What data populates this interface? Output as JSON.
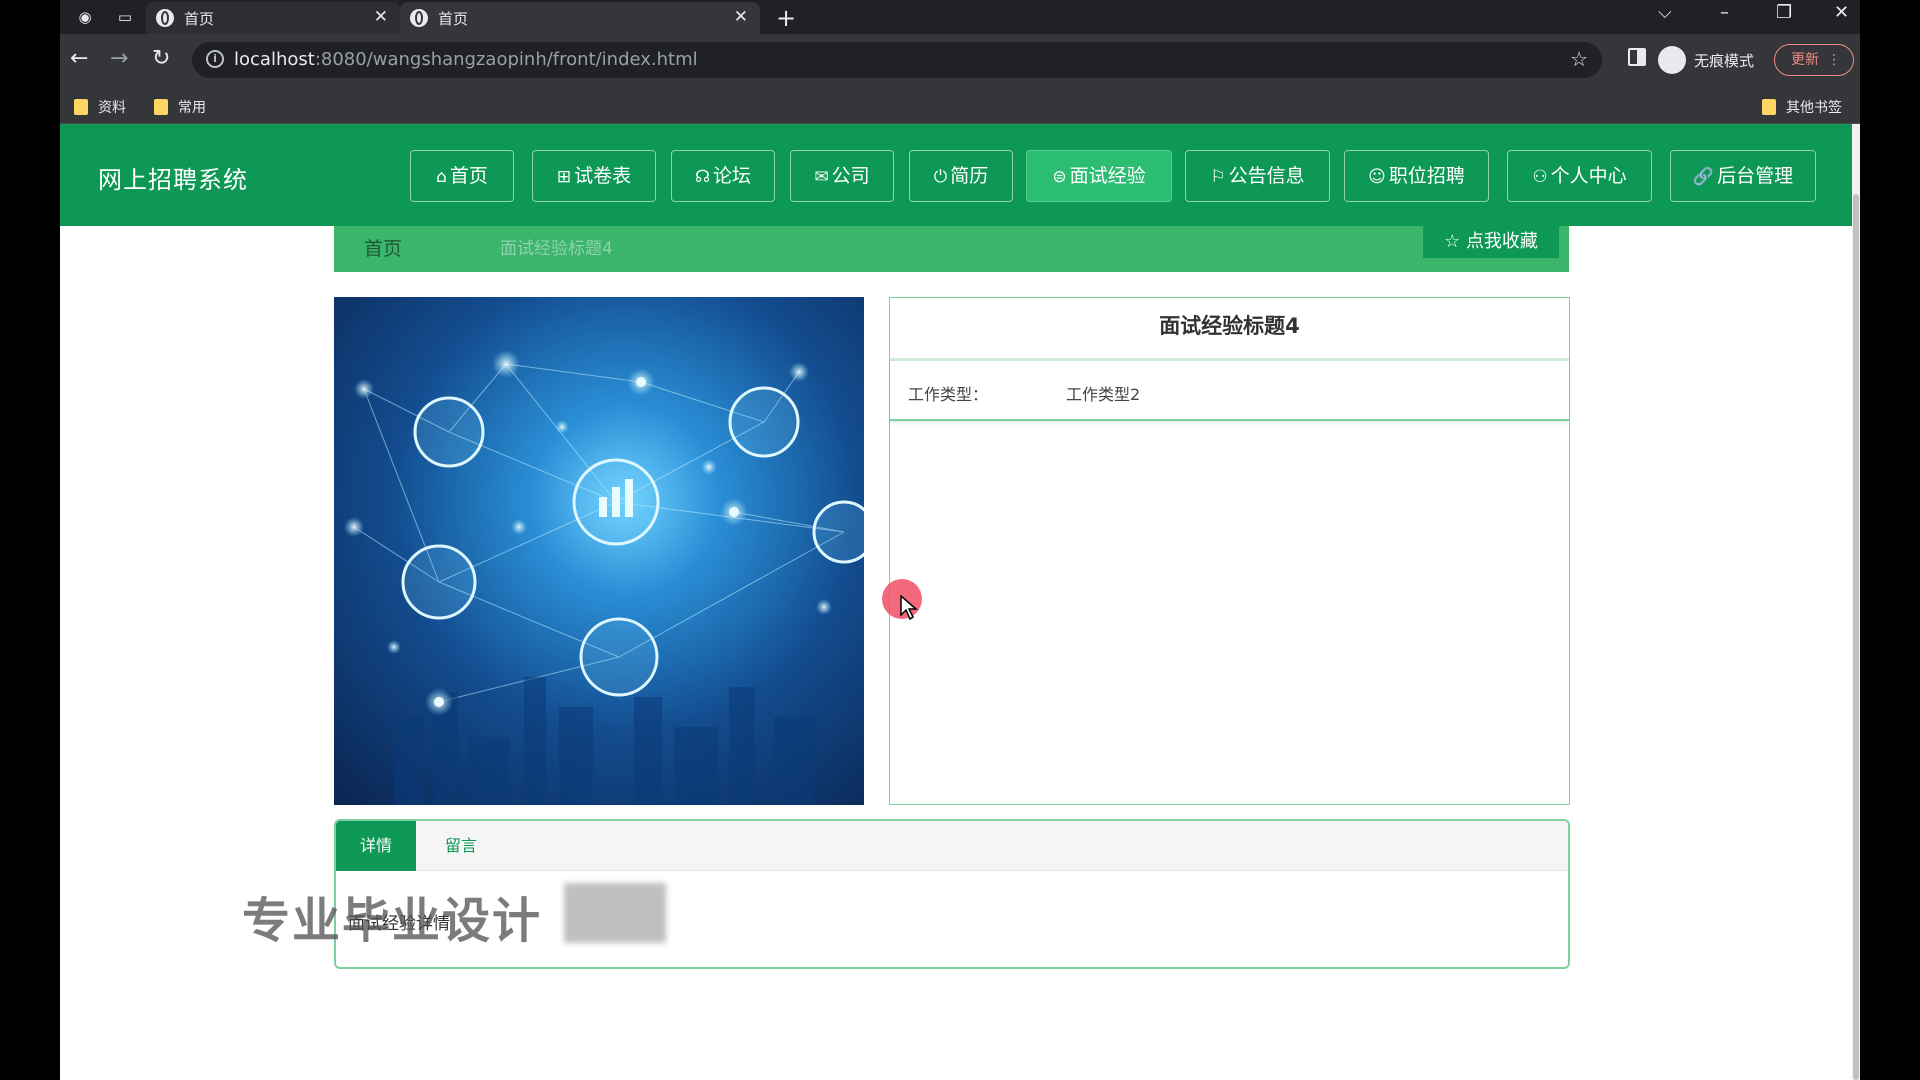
{
  "browser": {
    "tabs": [
      {
        "title": "首页",
        "active": false
      },
      {
        "title": "首页",
        "active": true
      }
    ],
    "url_host": "localhost",
    "url_path": ":8080/wangshangzaopinh/front/index.html",
    "incognito_label": "无痕模式",
    "update_label": "更新",
    "bookmarks": [
      "资料",
      "常用"
    ],
    "other_bookmarks": "其他书签"
  },
  "site": {
    "title": "网上招聘系统",
    "nav": [
      {
        "label": "首页",
        "icon": "home-icon",
        "glyph": "⌂"
      },
      {
        "label": "试卷表",
        "icon": "gift-icon",
        "glyph": "⊞"
      },
      {
        "label": "论坛",
        "icon": "chat-icon",
        "glyph": "☊"
      },
      {
        "label": "公司",
        "icon": "mail-icon",
        "glyph": "✉"
      },
      {
        "label": "简历",
        "icon": "power-icon",
        "glyph": "⏻"
      },
      {
        "label": "面试经验",
        "icon": "database-icon",
        "glyph": "⊜",
        "active": true
      },
      {
        "label": "公告信息",
        "icon": "flag-icon",
        "glyph": "⚐"
      },
      {
        "label": "职位招聘",
        "icon": "smile-icon",
        "glyph": "☺"
      },
      {
        "label": "个人中心",
        "icon": "user-icon",
        "glyph": "⚇"
      },
      {
        "label": "后台管理",
        "icon": "link-icon",
        "glyph": "🔗"
      }
    ]
  },
  "breadcrumb": {
    "home": "首页",
    "current": "面试经验标题4"
  },
  "favorite_button": "点我收藏",
  "detail": {
    "title": "面试经验标题4",
    "fields": [
      {
        "label": "工作类型：",
        "value": "工作类型2"
      }
    ]
  },
  "tabs": {
    "items": [
      "详情",
      "留言"
    ],
    "active": "详情",
    "body_text": "面试经验详情"
  },
  "watermark": "专业毕业设计",
  "colors": {
    "brand": "#0d9955",
    "breadcrumb_bg": "#3bb56c",
    "active_nav": "#2bbd72"
  }
}
